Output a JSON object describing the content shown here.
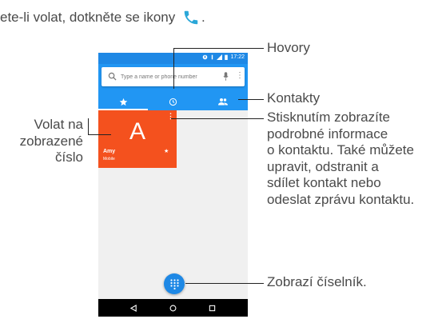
{
  "intro_text": "ete-li volat, dotkněte se ikony",
  "phone": {
    "status_time": "17:22",
    "search_placeholder": "Type a name or phone number",
    "search_more": "⋮",
    "card": {
      "letter": "A",
      "menu": "⋮",
      "name": "Amy",
      "type": "Mobile",
      "star": "★"
    },
    "icons": {
      "status": [
        "notification-icon",
        "wifi-icon",
        "signal-icon",
        "battery-icon"
      ],
      "tabs": [
        "star-icon",
        "clock-icon",
        "people-icon"
      ],
      "fab": "dialpad-icon",
      "nav": [
        "back-icon",
        "home-icon",
        "recents-icon"
      ]
    }
  },
  "annotations": {
    "hovory": "Hovory",
    "kontakty": "Kontakty",
    "details_lines": [
      "Stisknutím zobrazíte",
      "podrobné informace",
      "o kontaktu. Také můžete",
      "upravit, odstranit a",
      "sdílet kontakt nebo",
      "odeslat zprávu kontaktu."
    ],
    "volat_lines": [
      "Volat na",
      "zobrazené",
      "číslo"
    ],
    "dialer": "Zobrazí číselník."
  },
  "colors": {
    "app_blue": "#2196f3",
    "status_blue": "#1e88e5",
    "card_orange": "#f4511e",
    "phone_icon_blue": "#2aa7d8"
  }
}
